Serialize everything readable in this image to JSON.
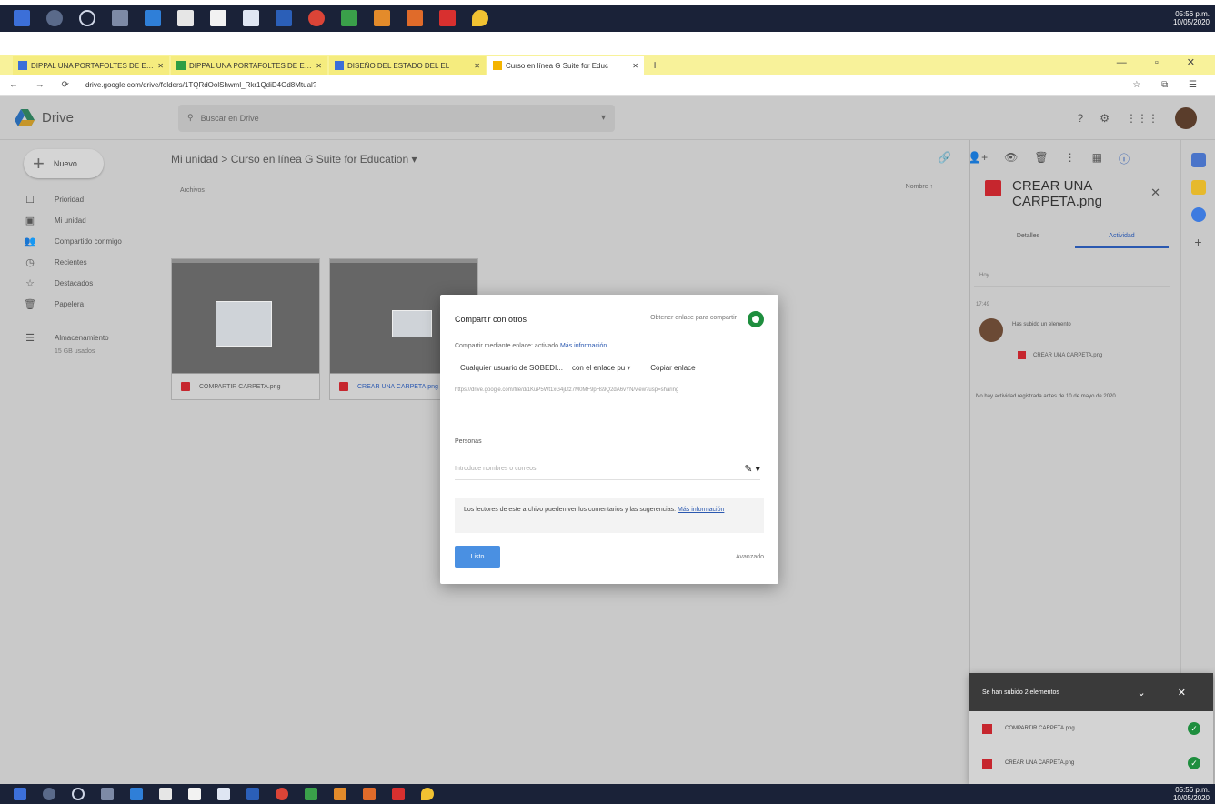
{
  "taskbar_top": {
    "clock_time": "05:56 p.m.",
    "clock_date": "10/05/2020"
  },
  "taskbar_bottom": {
    "clock_time": "05:56 p.m.",
    "clock_date": "10/05/2020"
  },
  "colors": {
    "tab_bar": "#f8f29a",
    "accent_blue": "#2a58b0",
    "file_red": "#c6262e",
    "toggle_green": "#1e8e3e",
    "overlay_gray": "#c9c9c9"
  },
  "browser": {
    "tabs": [
      {
        "label": "DIPPAL UNA PORTAFOLTES DE EVIDET",
        "active": false,
        "favicon_color": "#3b6fd8"
      },
      {
        "label": "DIPPAL UNA PORTAFOLTES DE EVIDET",
        "active": false,
        "favicon_color": "#2e9e44"
      },
      {
        "label": "DISEÑO DEL ESTADO DEL EL",
        "active": false,
        "favicon_color": "#3b6fd8"
      },
      {
        "label": "Curso en línea G Suite for Educ",
        "active": true,
        "favicon_color": "#f4b400"
      }
    ],
    "new_tab": "+",
    "window_controls": "— ▫ ✕",
    "nav_buttons": "← → ⟳",
    "url": "drive.google.com/drive/folders/1TQRdOolShwml_Rkr1QdiD4Od8Mtual?",
    "right_icons": "☆ ⧉ ☰"
  },
  "drive": {
    "logo_text": "Drive",
    "search_placeholder": "Buscar en Drive",
    "search_caret": "▾",
    "header_icons": [
      "?",
      "⚙",
      "⋮⋮⋮"
    ],
    "new_button": "Nuevo",
    "new_plus": "+",
    "sidebar": [
      {
        "icon": "☐",
        "label": "Prioridad"
      },
      {
        "icon": "▣",
        "label": "Mi unidad"
      },
      {
        "icon": "👥",
        "label": "Compartido conmigo"
      },
      {
        "icon": "◷",
        "label": "Recientes"
      },
      {
        "icon": "☆",
        "label": "Destacados"
      },
      {
        "icon": "🗑",
        "label": "Papelera"
      }
    ],
    "storage_label": "Almacenamiento",
    "storage_sub": "15 GB usados",
    "breadcrumb": "Mi unidad  >  Curso en línea G Suite for Education  ▾",
    "toolbar_icons": [
      "🔗",
      "👤+",
      "👁",
      "🗑",
      "⋮",
      "▦",
      "ⓘ"
    ],
    "section_label": "Archivos",
    "sort_label": "Nombre ↑",
    "files": [
      {
        "name": "COMPARTIR CARPETA.png",
        "selected": false
      },
      {
        "name": "CREAR UNA CARPETA.png",
        "selected": true
      }
    ]
  },
  "dialog": {
    "title": "Compartir con otros",
    "advanced_top": "Obtener enlace para compartir",
    "status": "Compartir mediante enlace: activado",
    "status_link": "Más información",
    "dropdown": "Cualquier usuario de SOBEDI...",
    "permission": "con el enlace pu",
    "arrow": "▾",
    "copy_link": "Copiar enlace",
    "share_url": "https://drive.google.com/file/d/1KuP5Wt1xG4jLtz7M0MF9pHs9Q2dA6vYN/view?usp=sharing",
    "people_label": "Personas",
    "people_placeholder": "Introduce nombres o correos",
    "pencil": "✎ ▾",
    "note": "Los lectores de este archivo pueden ver los comentarios y las sugerencias.",
    "note_link": "Más información",
    "done_button": "Listo",
    "advanced_bottom": "Avanzado"
  },
  "panel": {
    "title": "CREAR UNA CARPETA.png",
    "close": "✕",
    "tabs": [
      {
        "label": "Detalles",
        "active": false
      },
      {
        "label": "Actividad",
        "active": true
      }
    ],
    "filter": "Hoy",
    "date": "17:49",
    "activity_text": "Has subido un elemento",
    "activity_file": "CREAR UNA CARPETA.png",
    "note": "No hay actividad registrada antes de 10 de mayo de 2020"
  },
  "upload": {
    "header": "Se han subido 2 elementos",
    "controls": "⌄ ✕",
    "items": [
      {
        "name": "COMPARTIR CARPETA.png",
        "done": "✓"
      },
      {
        "name": "CREAR UNA CARPETA.png",
        "done": "✓"
      }
    ]
  }
}
